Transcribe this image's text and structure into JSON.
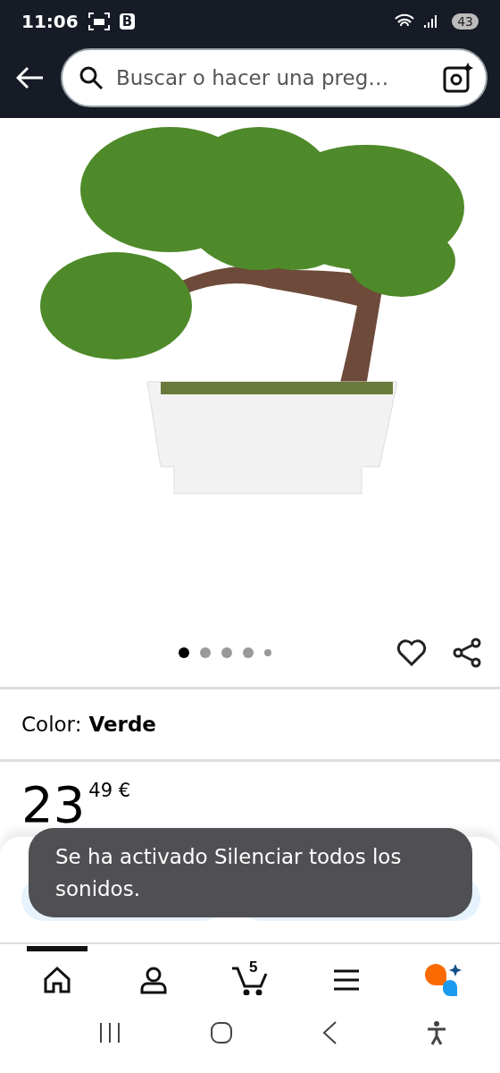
{
  "status_bar": {
    "time": "11:06",
    "badge": "B",
    "battery": "43"
  },
  "header": {
    "search": {
      "placeholder": "Buscar o hacer una preg…"
    }
  },
  "gallery": {
    "dots": [
      {
        "selected": true
      },
      {
        "selected": false
      },
      {
        "selected": false
      },
      {
        "selected": false
      },
      {
        "selected": false
      }
    ]
  },
  "variant": {
    "label": "Color:",
    "value": "Verde"
  },
  "price": {
    "whole": "23",
    "fraction": "49",
    "currency": "€"
  },
  "toast": {
    "text": "Se ha activado Silenciar todos los sonidos."
  },
  "bottom_nav": [
    {
      "kind": "home",
      "selected": true
    },
    {
      "kind": "account",
      "selected": false
    },
    {
      "kind": "cart",
      "selected": false,
      "badge": "5"
    },
    {
      "kind": "menu",
      "selected": false
    },
    {
      "kind": "assistant",
      "selected": false
    }
  ]
}
